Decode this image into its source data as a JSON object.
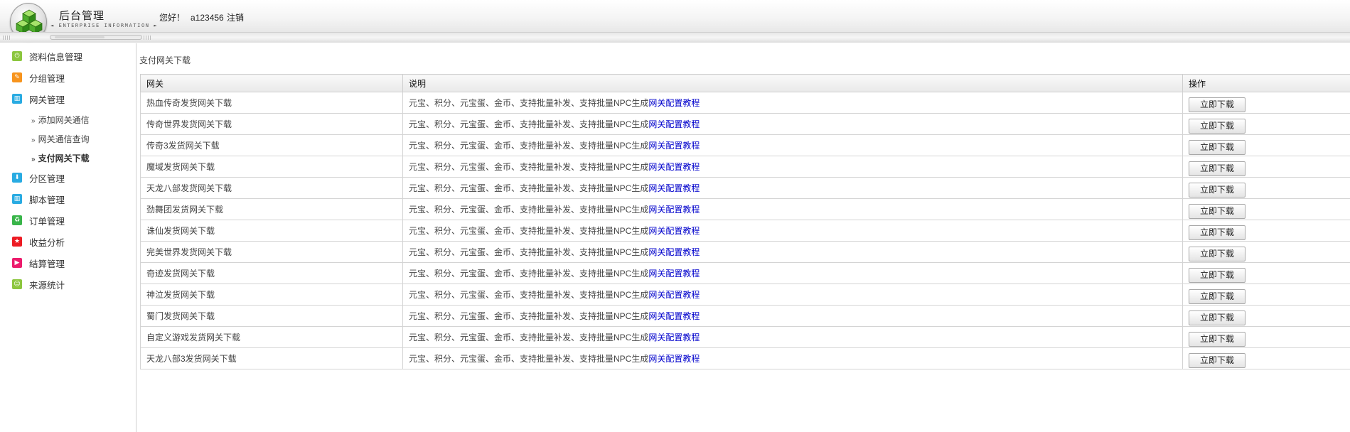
{
  "header": {
    "brand_title": "后台管理",
    "brand_subtitle": "ENTERPRISE INFORMATION",
    "greeting": "您好！",
    "username": "a123456",
    "logout_label": "注销"
  },
  "sidebar": {
    "items": [
      {
        "label": "资料信息管理",
        "icon": "power-icon",
        "color": "#8cc63f"
      },
      {
        "label": "分组管理",
        "icon": "pencil-icon",
        "color": "#f7941d"
      },
      {
        "label": "网关管理",
        "icon": "grid-icon",
        "color": "#29abe2"
      },
      {
        "label": "分区管理",
        "icon": "download-arrow-icon",
        "color": "#29abe2"
      },
      {
        "label": "脚本管理",
        "icon": "grid-icon",
        "color": "#29abe2"
      },
      {
        "label": "订单管理",
        "icon": "recycle-icon",
        "color": "#39b54a"
      },
      {
        "label": "收益分析",
        "icon": "star-icon",
        "color": "#ed1c24"
      },
      {
        "label": "结算管理",
        "icon": "play-icon",
        "color": "#ec1c6c"
      },
      {
        "label": "来源统计",
        "icon": "smiley-icon",
        "color": "#8cc63f"
      }
    ],
    "subitems": [
      {
        "label": "添加网关通信",
        "active": false
      },
      {
        "label": "网关通信查询",
        "active": false
      },
      {
        "label": "支付网关下载",
        "active": true
      }
    ],
    "sub_prefix": "»"
  },
  "main": {
    "breadcrumb": "支付网关下载",
    "columns": [
      "网关",
      "说明",
      "操作"
    ],
    "description_text": "元宝、积分、元宝蛋、金币、支持批量补发、支持批量NPC生成",
    "tutorial_link": "网关配置教程",
    "download_label": "立即下载",
    "rows": [
      "热血传奇发货网关下载",
      "传奇世界发货网关下载",
      "传奇3发货网关下载",
      "魔域发货网关下载",
      "天龙八部发货网关下载",
      "劲舞团发货网关下载",
      "诛仙发货网关下载",
      "完美世界发货网关下载",
      "奇迹发货网关下载",
      "神泣发货网关下载",
      "蜀门发货网关下载",
      "自定义游戏发货网关下载",
      "天龙八部3发货网关下载"
    ]
  }
}
